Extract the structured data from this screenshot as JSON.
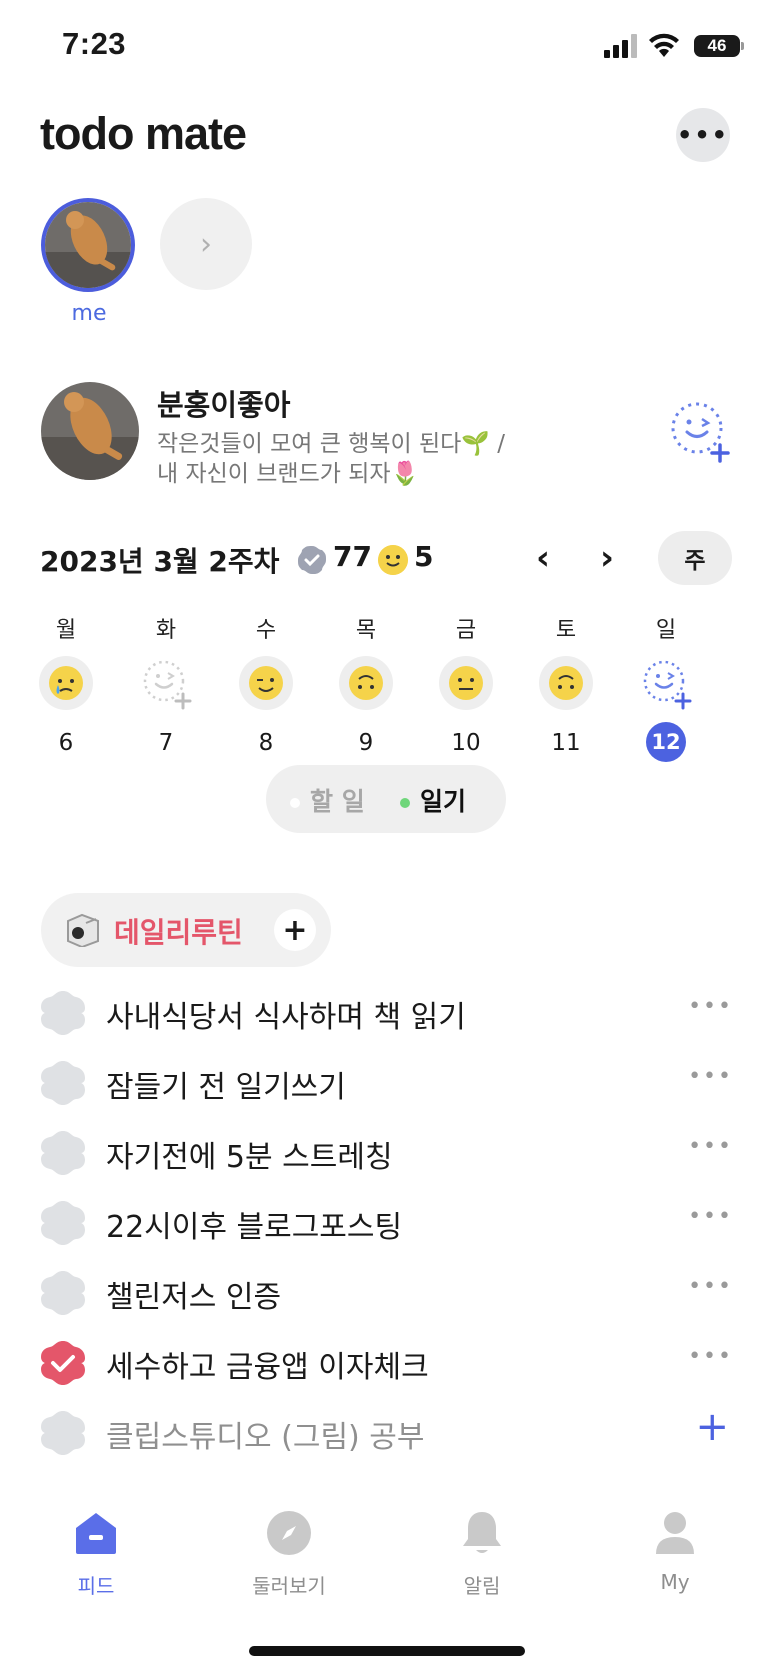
{
  "status_bar": {
    "time": "7:23",
    "battery": "46"
  },
  "app": {
    "title": "todo mate"
  },
  "friends": {
    "me_label": "me"
  },
  "profile": {
    "name": "분홍이좋아",
    "bio_line1": "작은것들이 모여 큰 행복이 된다🌱 /",
    "bio_line2": "내 자신이 브랜드가 되자🌷"
  },
  "week": {
    "title": "2023년 3월 2주차",
    "check_count": "77",
    "mood_count": "5",
    "view_toggle": "주",
    "days": [
      {
        "name": "월",
        "num": "6",
        "mood": "crying-face"
      },
      {
        "name": "화",
        "num": "7",
        "mood": "add-mood"
      },
      {
        "name": "수",
        "num": "8",
        "mood": "winking-face"
      },
      {
        "name": "목",
        "num": "9",
        "mood": "upside-down-face"
      },
      {
        "name": "금",
        "num": "10",
        "mood": "neutral-face"
      },
      {
        "name": "토",
        "num": "11",
        "mood": "upside-down-face"
      },
      {
        "name": "일",
        "num": "12",
        "mood": "add-mood",
        "today": true
      }
    ]
  },
  "segment": {
    "todo": "할 일",
    "diary": "일기",
    "diary_dot_color": "#6fd67a",
    "todo_dot_color": "#ffffff"
  },
  "routine": {
    "label": "데일리루틴",
    "color": "#e4566a",
    "tasks": [
      {
        "text": "사내식당서 식사하며 책  읽기",
        "done": false
      },
      {
        "text": "잠들기 전 일기쓰기",
        "done": false
      },
      {
        "text": "자기전에 5분 스트레칭",
        "done": false
      },
      {
        "text": "22시이후 블로그포스팅",
        "done": false
      },
      {
        "text": "챌린저스 인증",
        "done": false
      },
      {
        "text": "세수하고 금융앱 이자체크",
        "done": true
      },
      {
        "text": "클립스튜디오 (그림) 공부",
        "done": false,
        "draft": true
      }
    ]
  },
  "nav": {
    "feed": "피드",
    "explore": "둘러보기",
    "alerts": "알림",
    "my": "My",
    "active_color": "#5a6ee8"
  }
}
